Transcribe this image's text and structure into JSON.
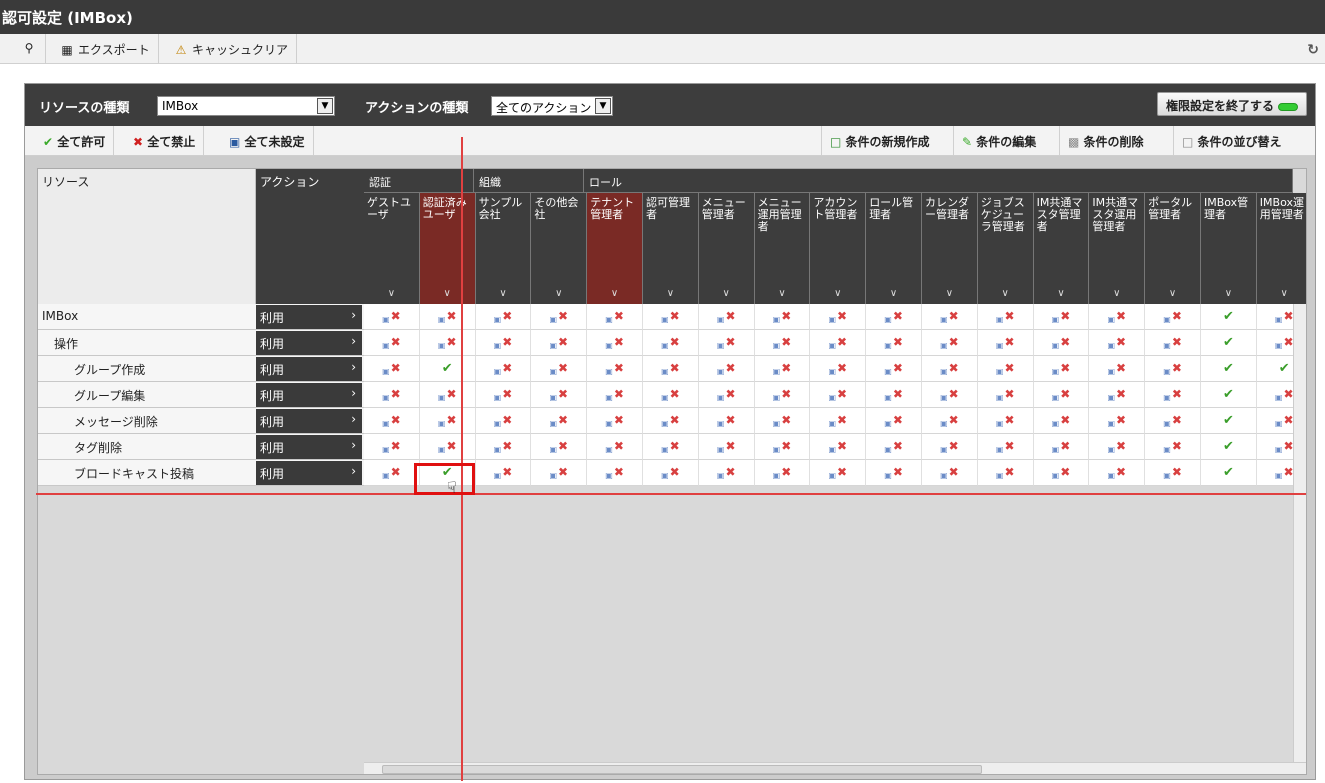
{
  "window": {
    "title": "認可設定 (IMBox)"
  },
  "toolbar": {
    "search_icon": "search-icon",
    "export_label": "エクスポート",
    "cache_clear_label": "キャッシュクリア",
    "refresh_icon": "refresh-icon"
  },
  "panel": {
    "resource_type_label": "リソースの種類",
    "resource_type_value": "IMBox",
    "action_type_label": "アクションの種類",
    "action_type_value": "全てのアクション",
    "end_button_label": "権限設定を終了する"
  },
  "actions": {
    "allow_all": "全て許可",
    "deny_all": "全て禁止",
    "unset_all": "全て未設定",
    "new_condition": "条件の新規作成",
    "edit_condition": "条件の編集",
    "delete_condition": "条件の削除",
    "sort_condition": "条件の並び替え"
  },
  "grid": {
    "resource_header": "リソース",
    "action_header": "アクション",
    "groups": [
      {
        "label": "認証"
      },
      {
        "label": "組織"
      },
      {
        "label": "ロール"
      }
    ],
    "columns": [
      {
        "label": "ゲストユーザ"
      },
      {
        "label": "認証済みユーザ"
      },
      {
        "label": "サンプル会社"
      },
      {
        "label": "その他会社"
      },
      {
        "label": "テナント管理者"
      },
      {
        "label": "認可管理者"
      },
      {
        "label": "メニュー管理者"
      },
      {
        "label": "メニュー運用管理者"
      },
      {
        "label": "アカウント管理者"
      },
      {
        "label": "ロール管理者"
      },
      {
        "label": "カレンダー管理者"
      },
      {
        "label": "ジョブスケジューラ管理者"
      },
      {
        "label": "IM共通マスタ管理者"
      },
      {
        "label": "IM共通マスタ運用管理者"
      },
      {
        "label": "ポータル管理者"
      },
      {
        "label": "IMBox管理者"
      },
      {
        "label": "IMBox運用管理者"
      }
    ],
    "rows": [
      {
        "name": "IMBox",
        "action": "利用",
        "marks": [
          "x",
          "x",
          "x",
          "x",
          "x",
          "x",
          "x",
          "x",
          "x",
          "x",
          "x",
          "x",
          "x",
          "x",
          "x",
          "ok",
          "x"
        ]
      },
      {
        "name": "操作",
        "action": "利用",
        "marks": [
          "x",
          "x",
          "x",
          "x",
          "x",
          "x",
          "x",
          "x",
          "x",
          "x",
          "x",
          "x",
          "x",
          "x",
          "x",
          "ok",
          "x"
        ]
      },
      {
        "name": "グループ作成",
        "action": "利用",
        "marks": [
          "x",
          "ok",
          "x",
          "x",
          "x",
          "x",
          "x",
          "x",
          "x",
          "x",
          "x",
          "x",
          "x",
          "x",
          "x",
          "ok",
          "ok"
        ]
      },
      {
        "name": "グループ編集",
        "action": "利用",
        "marks": [
          "x",
          "x",
          "x",
          "x",
          "x",
          "x",
          "x",
          "x",
          "x",
          "x",
          "x",
          "x",
          "x",
          "x",
          "x",
          "ok",
          "x"
        ]
      },
      {
        "name": "メッセージ削除",
        "action": "利用",
        "marks": [
          "x",
          "x",
          "x",
          "x",
          "x",
          "x",
          "x",
          "x",
          "x",
          "x",
          "x",
          "x",
          "x",
          "x",
          "x",
          "ok",
          "x"
        ]
      },
      {
        "name": "タグ削除",
        "action": "利用",
        "marks": [
          "x",
          "x",
          "x",
          "x",
          "x",
          "x",
          "x",
          "x",
          "x",
          "x",
          "x",
          "x",
          "x",
          "x",
          "x",
          "ok",
          "x"
        ]
      },
      {
        "name": "ブロードキャスト投稿",
        "action": "利用",
        "marks": [
          "x",
          "ok",
          "x",
          "x",
          "x",
          "x",
          "x",
          "x",
          "x",
          "x",
          "x",
          "x",
          "x",
          "x",
          "x",
          "ok",
          "x"
        ]
      }
    ]
  },
  "colors": {
    "accent_red": "#e01010",
    "ok_green": "#3a9e2a",
    "header_dark": "#3d3d3d",
    "selected_col": "#7a2a25"
  }
}
